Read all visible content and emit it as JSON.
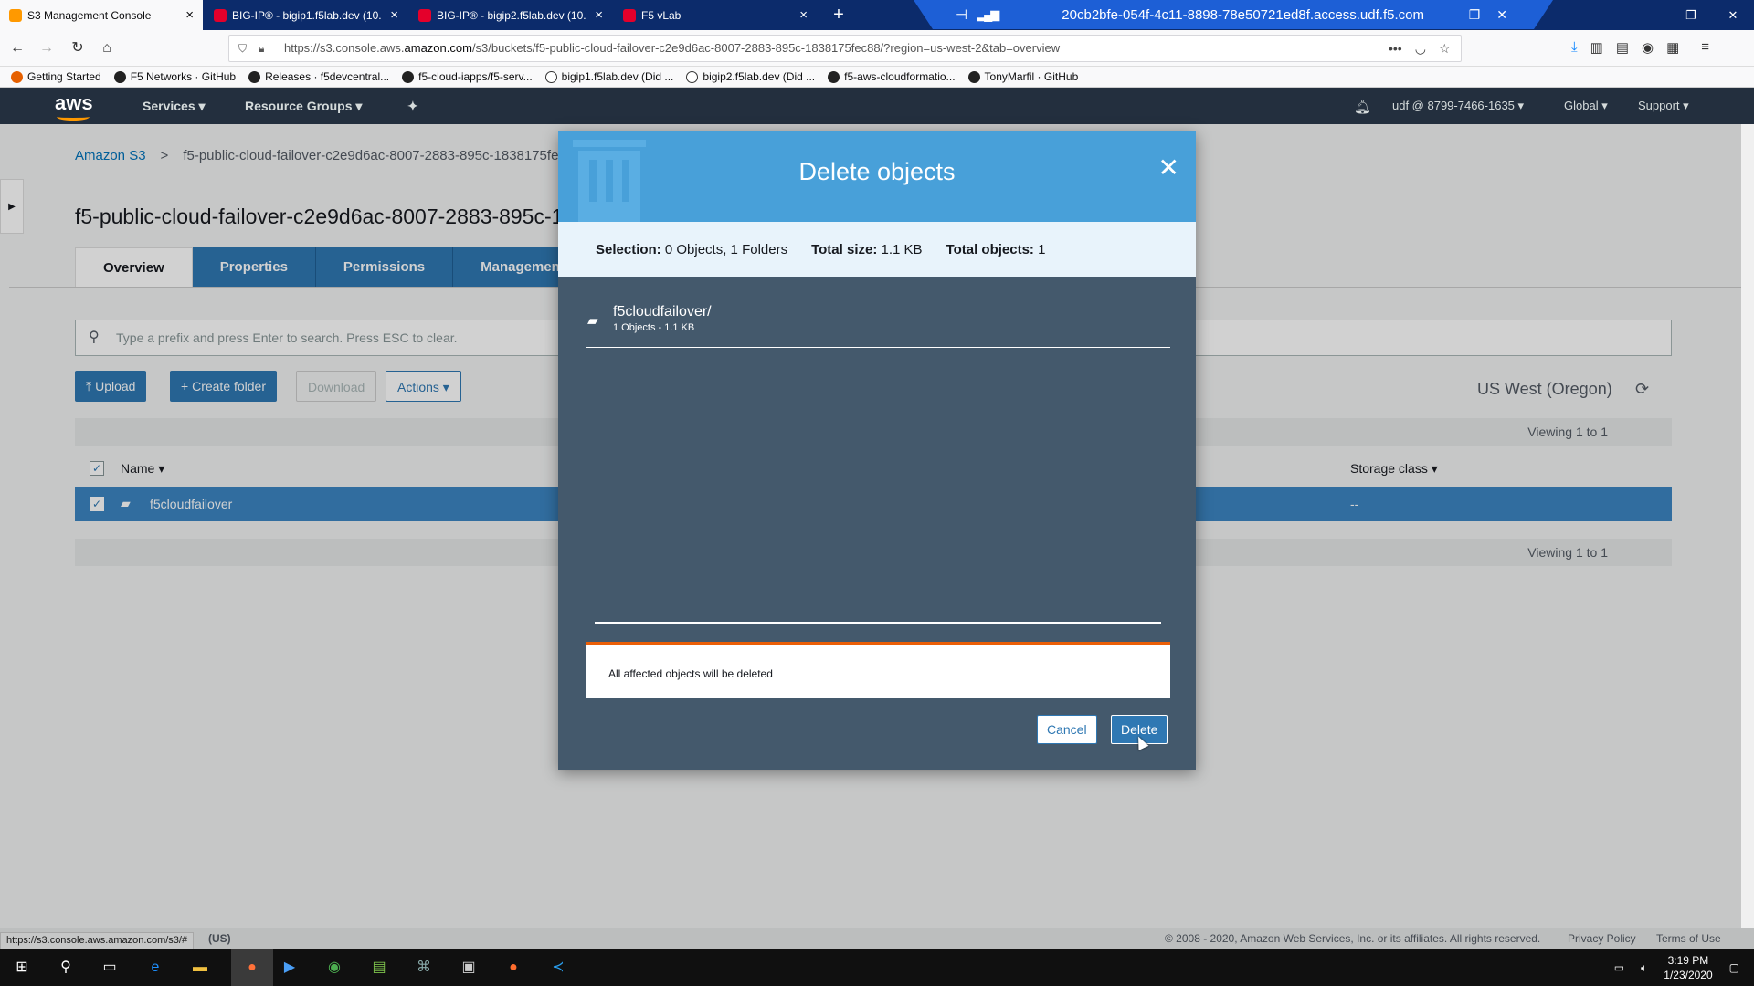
{
  "browser": {
    "tabs": [
      {
        "title": "S3 Management Console",
        "color": "#f90"
      },
      {
        "title": "BIG-IP® - bigip1.f5lab.dev (10.",
        "color": "#e4002b"
      },
      {
        "title": "BIG-IP® - bigip2.f5lab.dev (10.",
        "color": "#e4002b"
      },
      {
        "title": "F5 vLab",
        "color": "#e4002b"
      }
    ],
    "new_tab": "+",
    "remote_host": "20cb2bfe-054f-4c11-8898-78e50721ed8f.access.udf.f5.com",
    "url_prefix": "https://s3.console.aws.",
    "url_host": "amazon.com",
    "url_suffix": "/s3/buckets/f5-public-cloud-failover-c2e9d6ac-8007-2883-895c-1838175fec88/?region=us-west-2&tab=overview",
    "bookmarks": [
      "Getting Started",
      "F5 Networks · GitHub",
      "Releases · f5devcentral...",
      "f5-cloud-iapps/f5-serv...",
      "bigip1.f5lab.dev (Did ...",
      "bigip2.f5lab.dev (Did ...",
      "f5-aws-cloudformatio...",
      "TonyMarfil · GitHub"
    ],
    "status_url": "https://s3.console.aws.amazon.com/s3/#"
  },
  "aws_nav": {
    "logo": "aws",
    "services": "Services ▾",
    "resource_groups": "Resource Groups ▾",
    "account": "udf @ 8799-7466-1635 ▾",
    "region": "Global ▾",
    "support": "Support ▾"
  },
  "page": {
    "breadcrumb_root": "Amazon S3",
    "breadcrumb_sep": ">",
    "breadcrumb_bucket": "f5-public-cloud-failover-c2e9d6ac-8007-2883-895c-1838175fec88",
    "bucket_title": "f5-public-cloud-failover-c2e9d6ac-8007-2883-895c-1838175fec88",
    "tabs": [
      "Overview",
      "Properties",
      "Permissions",
      "Management"
    ],
    "search_placeholder": "Type a prefix and press Enter to search. Press ESC to clear.",
    "upload": "Upload",
    "create_folder": "Create folder",
    "download": "Download",
    "actions": "Actions ▾",
    "region": "US West (Oregon)",
    "viewing": "Viewing 1 to 1",
    "col_name": "Name ▾",
    "col_storage_class": "Storage class ▾",
    "row_name": "f5cloudfailover",
    "row_storage_class": "--",
    "footer_lang": "(US)",
    "copyright": "© 2008 - 2020, Amazon Web Services, Inc. or its affiliates. All rights reserved.",
    "privacy": "Privacy Policy",
    "terms": "Terms of Use"
  },
  "modal": {
    "title": "Delete objects",
    "selection_label": "Selection:",
    "selection_value": "0 Objects, 1 Folders",
    "size_label": "Total size:",
    "size_value": "1.1 KB",
    "objects_label": "Total objects:",
    "objects_value": "1",
    "item_name": "f5cloudfailover/",
    "item_sub": "1 Objects - 1.1 KB",
    "warning": "All affected objects will be deleted",
    "cancel": "Cancel",
    "delete": "Delete"
  },
  "taskbar": {
    "time": "3:19 PM",
    "date": "1/23/2020"
  },
  "colors": {
    "modal_header": "#48a0d9",
    "modal_body": "#44596c",
    "aws_nav": "#232f3e",
    "warning_accent": "#eb5f07"
  }
}
